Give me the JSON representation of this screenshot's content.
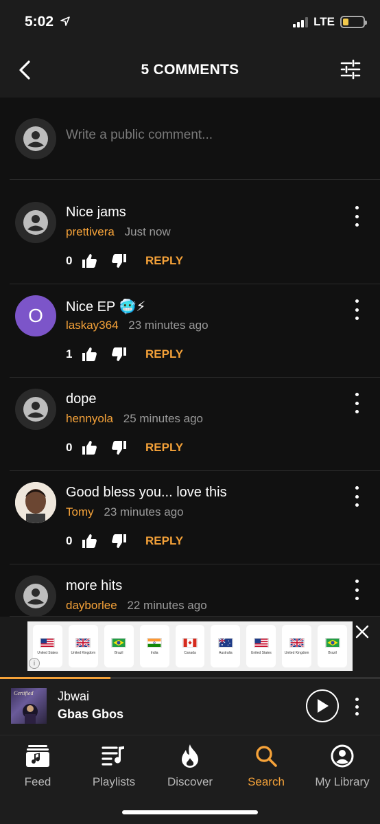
{
  "status": {
    "time": "5:02",
    "network": "LTE",
    "battery_level": 0.3
  },
  "header": {
    "title": "5 COMMENTS"
  },
  "compose": {
    "placeholder": "Write a public comment..."
  },
  "comments": [
    {
      "text": "Nice jams",
      "user": "prettivera",
      "time": "Just now",
      "likes": "0",
      "reply": "REPLY",
      "avatar": "default"
    },
    {
      "text": "Nice EP 🥶⚡",
      "user": "laskay364",
      "time": "23 minutes ago",
      "likes": "1",
      "reply": "REPLY",
      "avatar": "letter",
      "avatar_letter": "O",
      "avatar_color": "#7c55c9"
    },
    {
      "text": "dope",
      "user": "hennyola",
      "time": "25 minutes ago",
      "likes": "0",
      "reply": "REPLY",
      "avatar": "default"
    },
    {
      "text": "Good bless you... love this",
      "user": "Tomy",
      "time": "23 minutes ago",
      "likes": "0",
      "reply": "REPLY",
      "avatar": "photo"
    },
    {
      "text": "more hits",
      "user": "dayborlee",
      "time": "22 minutes ago",
      "avatar": "default"
    }
  ],
  "ad": {
    "flags": [
      {
        "name": "United States",
        "icon": "us-flag"
      },
      {
        "name": "United Kingdom",
        "icon": "uk-flag"
      },
      {
        "name": "Brazil",
        "icon": "brazil-flag"
      },
      {
        "name": "India",
        "icon": "india-flag"
      },
      {
        "name": "Canada",
        "icon": "canada-flag"
      },
      {
        "name": "Australia",
        "icon": "australia-flag"
      },
      {
        "name": "United States",
        "icon": "us-flag"
      },
      {
        "name": "United Kingdom",
        "icon": "uk-flag"
      },
      {
        "name": "Brazil",
        "icon": "brazil-flag"
      }
    ]
  },
  "player": {
    "artist": "Jbwai",
    "track": "Gbas Gbos",
    "cover_text": "Certified",
    "progress": 0.29
  },
  "tabs": [
    {
      "label": "Feed",
      "icon": "feed-icon"
    },
    {
      "label": "Playlists",
      "icon": "playlists-icon"
    },
    {
      "label": "Discover",
      "icon": "flame-icon"
    },
    {
      "label": "Search",
      "icon": "search-icon",
      "active": true
    },
    {
      "label": "My Library",
      "icon": "library-icon"
    }
  ],
  "colors": {
    "accent": "#f5a239",
    "background": "#111111",
    "bar": "#1d1d1d"
  }
}
